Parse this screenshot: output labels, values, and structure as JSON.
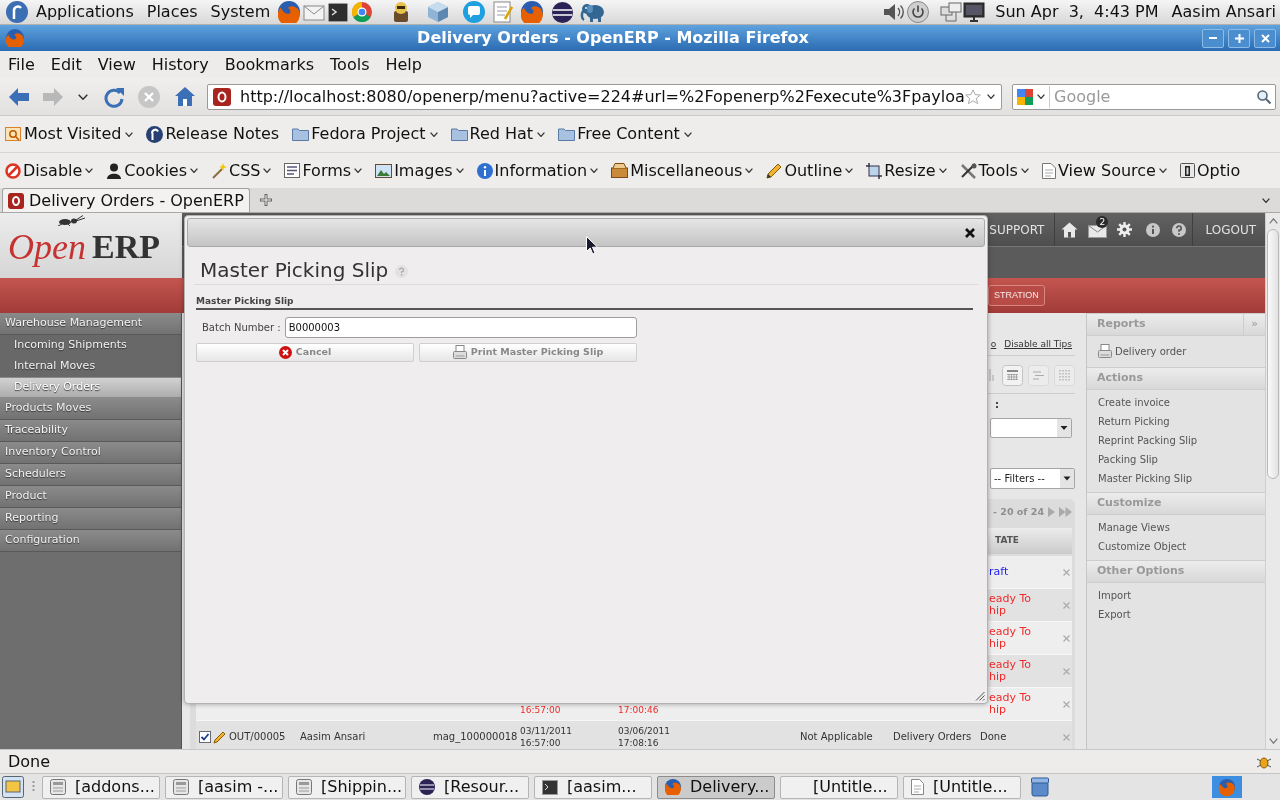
{
  "desktop_panel": {
    "menus": [
      "Applications",
      "Places",
      "System"
    ],
    "clock": "Sun Apr  3,  4:43 PM",
    "user": "Aasim Ansari"
  },
  "window": {
    "title": "Delivery Orders - OpenERP - Mozilla Firefox"
  },
  "menu_bar": [
    "File",
    "Edit",
    "View",
    "History",
    "Bookmarks",
    "Tools",
    "Help"
  ],
  "navigation": {
    "buttons": [
      {
        "kind": "back",
        "disabled": false
      },
      {
        "kind": "forward",
        "disabled": true
      },
      {
        "kind": "history",
        "disabled": false
      },
      {
        "kind": "reload",
        "disabled": false
      },
      {
        "kind": "stop",
        "disabled": true
      },
      {
        "kind": "home",
        "disabled": false
      }
    ],
    "url": "http://localhost:8080/openerp/menu?active=224#url=%2Fopenerp%2Fexecute%3Fpayloa",
    "search": {
      "placeholder": "Google"
    }
  },
  "bookmarks_toolbar": [
    {
      "label": "Most Visited",
      "kind": "smart",
      "dropdown": true
    },
    {
      "label": "Release Notes",
      "kind": "logo",
      "dropdown": false
    },
    {
      "label": "Fedora Project",
      "kind": "folder",
      "dropdown": true
    },
    {
      "label": "Red Hat",
      "kind": "folder",
      "dropdown": true
    },
    {
      "label": "Free Content",
      "kind": "folder",
      "dropdown": true
    }
  ],
  "developer_toolbar": [
    {
      "label": "Disable",
      "kind": "ban",
      "dropdown": true
    },
    {
      "label": "Cookies",
      "kind": "person",
      "dropdown": true
    },
    {
      "label": "CSS",
      "kind": "wand",
      "dropdown": true
    },
    {
      "label": "Forms",
      "kind": "form",
      "dropdown": true
    },
    {
      "label": "Images",
      "kind": "picture",
      "dropdown": true
    },
    {
      "label": "Information",
      "kind": "info",
      "dropdown": true
    },
    {
      "label": "Miscellaneous",
      "kind": "box",
      "dropdown": true
    },
    {
      "label": "Outline",
      "kind": "pencil",
      "dropdown": true
    },
    {
      "label": "Resize",
      "kind": "crop",
      "dropdown": true
    },
    {
      "label": "Tools",
      "kind": "wrench",
      "dropdown": true
    },
    {
      "label": "View Source",
      "kind": "page",
      "dropdown": true
    },
    {
      "label": "Optio",
      "kind": "slot",
      "dropdown": false
    }
  ],
  "tabs": [
    {
      "label": "Delivery Orders - OpenERP",
      "selected": true
    }
  ],
  "openerp": {
    "logo": {
      "first": "Open",
      "second": "ERP"
    },
    "header": {
      "support": "SUPPORT",
      "message_count": "2",
      "logout": "LOGOUT"
    },
    "menu_button": "STRATION",
    "sidebar": [
      {
        "label": "Warehouse Management",
        "children": [
          {
            "label": "Incoming Shipments",
            "selected": false
          },
          {
            "label": "Internal Moves",
            "selected": false
          },
          {
            "label": "Delivery Orders",
            "selected": true
          }
        ]
      },
      {
        "label": "Products Moves"
      },
      {
        "label": "Traceability"
      },
      {
        "label": "Inventory Control"
      },
      {
        "label": "Schedulers"
      },
      {
        "label": "Product"
      },
      {
        "label": "Reporting"
      },
      {
        "label": "Configuration"
      }
    ],
    "tips": {
      "link_fragment": "o",
      "disable_link": "Disable all Tips"
    },
    "field_label_fragment": ":",
    "filters": "-- Filters --",
    "pager": "- 20 of 24",
    "list": {
      "column_header": "TATE",
      "rows": [
        {
          "state": [
            "raft"
          ],
          "color": "#1f1ff5"
        },
        {
          "state": [
            "eady To",
            "hip"
          ],
          "color": "#f02b2b"
        },
        {
          "state": [
            "eady To",
            "hip"
          ],
          "color": "#f02b2b"
        },
        {
          "state": [
            "eady To",
            "hip"
          ],
          "color": "#f02b2b"
        },
        {
          "date": [
            "16:57:00"
          ],
          "expected": [
            "17:00:46"
          ],
          "state": [
            "eady To",
            "hip"
          ],
          "color": "#f02b2b"
        },
        {
          "checked": true,
          "reference": "OUT/00005",
          "partner": "Aasim Ansari",
          "origin": "mag_100000018",
          "date": [
            "03/11/2011",
            "16:57:00"
          ],
          "expected": [
            "03/06/2011",
            "17:08:16"
          ],
          "column_7": "Not Applicable",
          "column_8": "Delivery Orders",
          "state": [
            "Done"
          ],
          "color": "#333333"
        }
      ]
    },
    "side_panel": {
      "toggle": "»",
      "sections": [
        {
          "title": "Reports",
          "items": [
            {
              "label": "Delivery order",
              "kind": "report"
            }
          ]
        },
        {
          "title": "Actions",
          "items": [
            {
              "label": "Create invoice",
              "kind": "action"
            },
            {
              "label": "Return Picking",
              "kind": "action"
            },
            {
              "label": "Reprint Packing Slip",
              "kind": "action"
            },
            {
              "label": "Packing Slip",
              "kind": "action"
            },
            {
              "label": "Master Picking Slip",
              "kind": "action"
            }
          ]
        },
        {
          "title": "Customize",
          "items": [
            {
              "label": "Manage Views",
              "kind": "action"
            },
            {
              "label": "Customize Object",
              "kind": "action"
            }
          ]
        },
        {
          "title": "Other Options",
          "items": [
            {
              "label": "Import",
              "kind": "action"
            },
            {
              "label": "Export",
              "kind": "action"
            }
          ]
        }
      ]
    }
  },
  "dialog": {
    "title": "Master Picking Slip",
    "section": "Master Picking Slip",
    "field": {
      "label": "Batch Number :",
      "value": "B0000003"
    },
    "buttons": [
      {
        "label": "Cancel",
        "kind": "cancel"
      },
      {
        "label": "Print Master Picking Slip",
        "kind": "print"
      }
    ]
  },
  "status_bar": {
    "text": "Done"
  },
  "taskbar": [
    {
      "label": "[addons...",
      "kind": "document",
      "selected": false
    },
    {
      "label": "[aasim -...",
      "kind": "document",
      "selected": false
    },
    {
      "label": "[Shippin...",
      "kind": "document",
      "selected": false
    },
    {
      "label": "[Resour...",
      "kind": "sphere",
      "selected": false
    },
    {
      "label": "[aasim...",
      "kind": "terminal",
      "selected": false
    },
    {
      "label": "Delivery...",
      "kind": "browser",
      "selected": true
    },
    {
      "label": "[Untitle...",
      "kind": "blank",
      "selected": false
    },
    {
      "label": "[Untitle...",
      "kind": "text",
      "selected": false
    }
  ]
}
